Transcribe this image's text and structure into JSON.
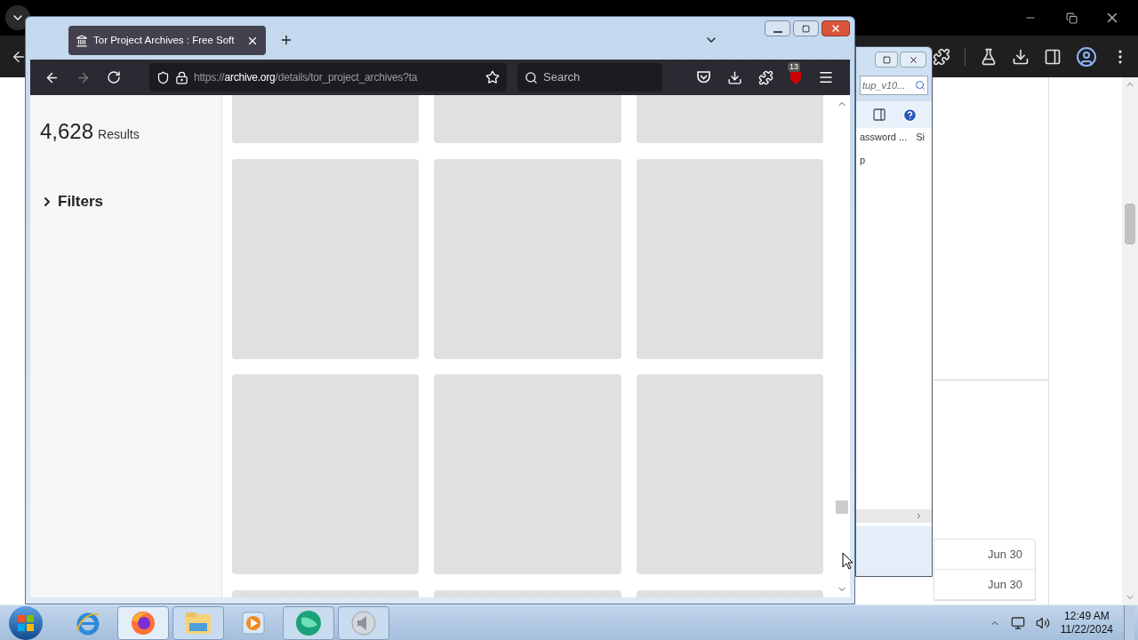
{
  "background_browser": {
    "rows": [
      {
        "date": "Jun 30"
      },
      {
        "date": "Jun 30"
      }
    ]
  },
  "explorer_window": {
    "search": {
      "value": "tup_v10..."
    },
    "columns": [
      "assword ...",
      "Si"
    ],
    "cell": "p"
  },
  "firefox": {
    "tab": {
      "title": "Tor Project Archives : Free Soft",
      "selected": true
    },
    "url": {
      "scheme": "https://",
      "domain": "archive.org",
      "path": "/details/tor_project_archives?ta"
    },
    "search": {
      "placeholder": "Search"
    },
    "addon_badge": "13",
    "results": {
      "count": "4,628",
      "label": "Results"
    },
    "filters": {
      "label": "Filters",
      "expanded": false
    }
  },
  "taskbar": {
    "apps": [
      {
        "kind": "ie",
        "running": false,
        "selected": false
      },
      {
        "kind": "firefox",
        "running": true,
        "selected": true
      },
      {
        "kind": "explorer",
        "running": true,
        "selected": false
      },
      {
        "kind": "media",
        "running": false,
        "selected": false
      },
      {
        "kind": "globe",
        "running": true,
        "selected": false
      },
      {
        "kind": "speaker",
        "running": true,
        "selected": false
      }
    ],
    "time": "12:49 AM",
    "date": "11/22/2024"
  }
}
